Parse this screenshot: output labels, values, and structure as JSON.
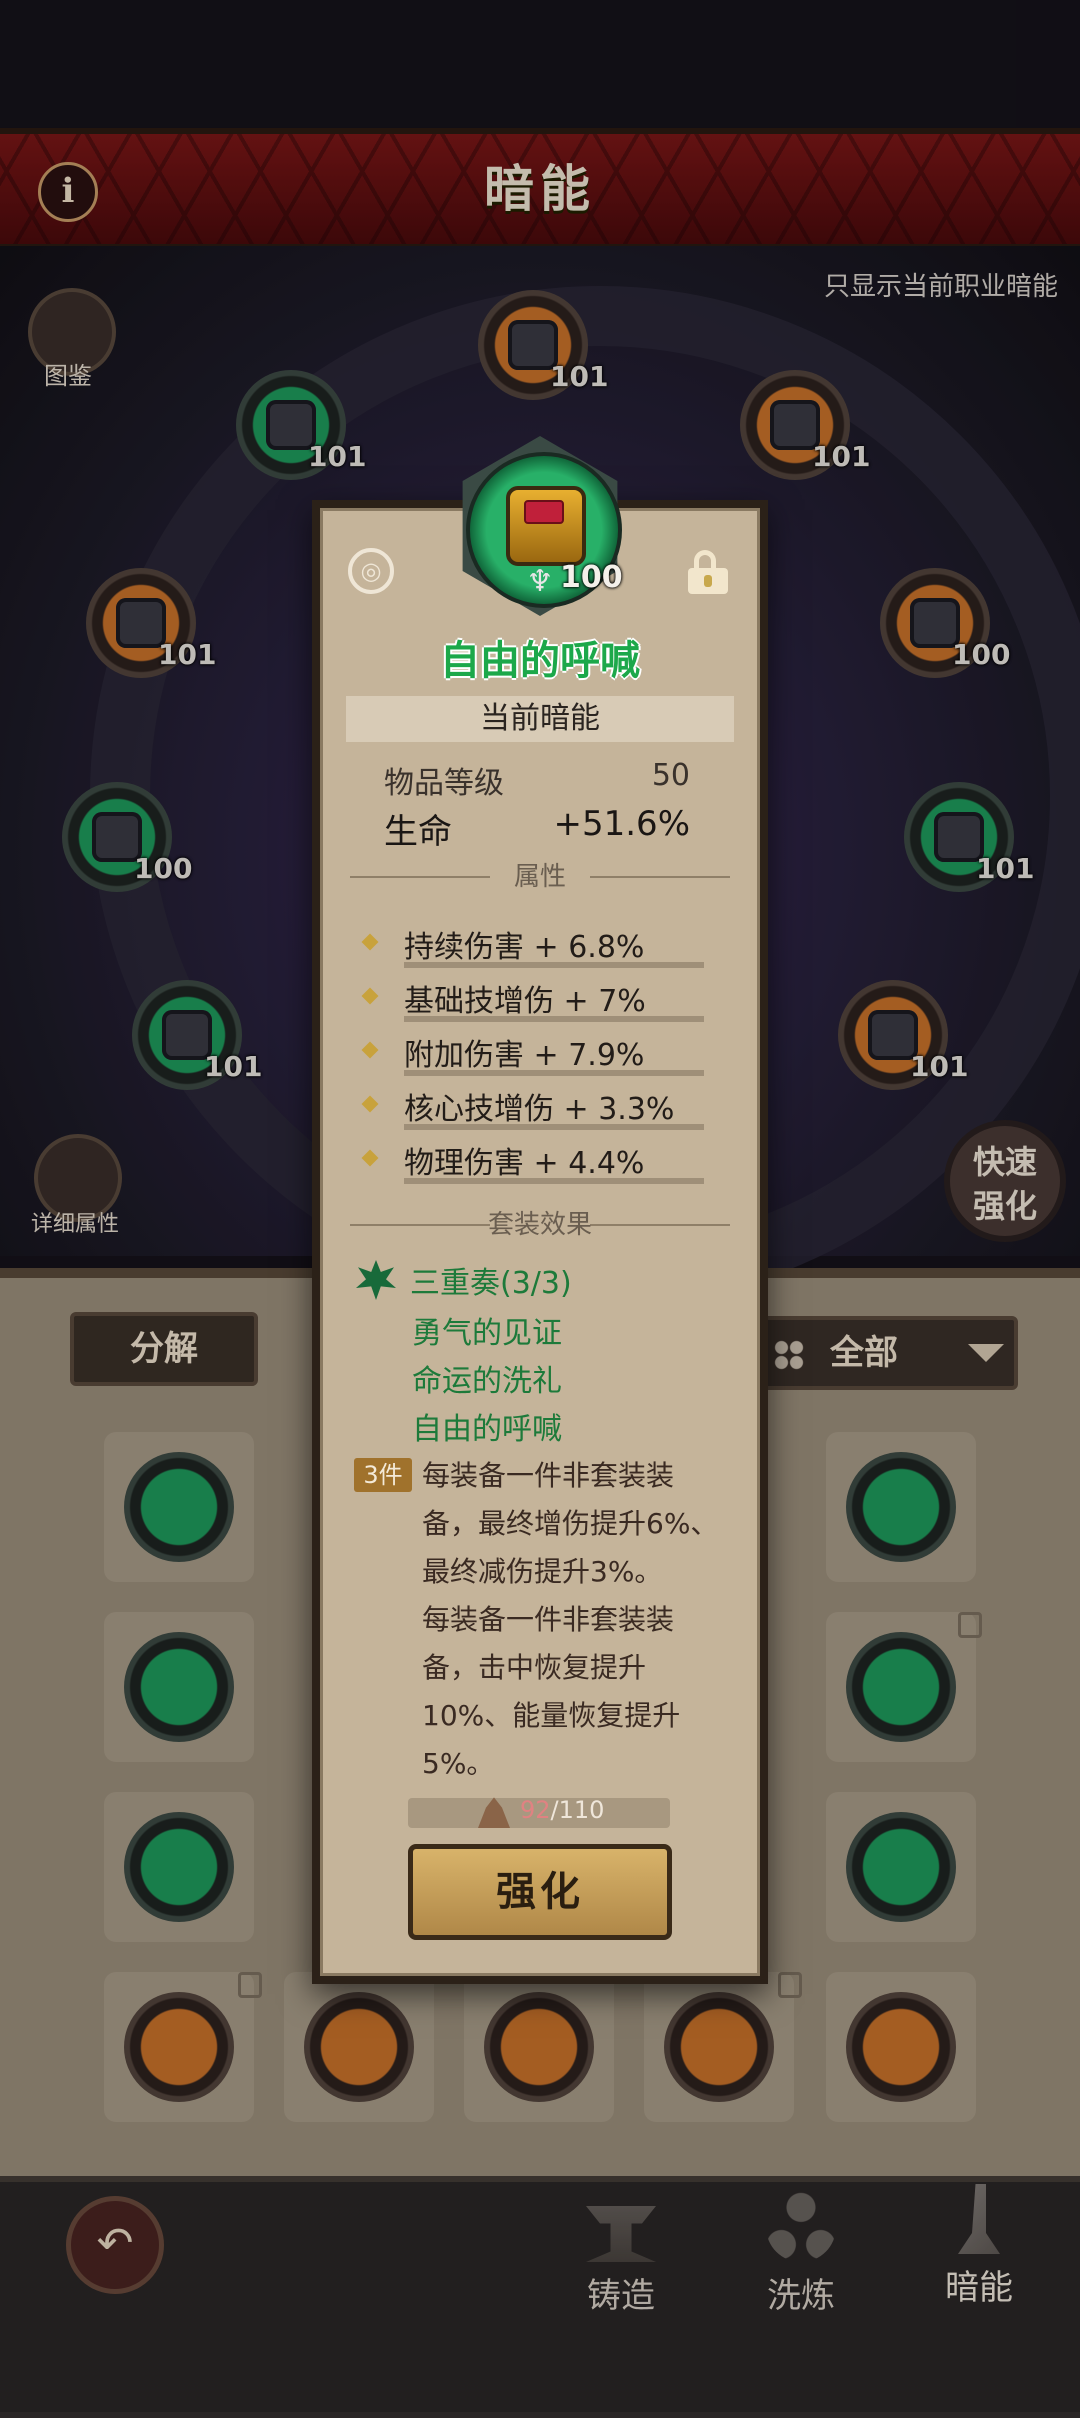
{
  "header": {
    "title": "暗能",
    "info_icon": "info-icon"
  },
  "scene": {
    "only_current_class": "只显示当前职业暗能",
    "codex_label": "图鉴",
    "detail_attr_label": "详细属性",
    "quick_enhance_label_1": "快速",
    "quick_enhance_label_2": "强化",
    "slots": [
      {
        "level": "101",
        "rarity": "orange"
      },
      {
        "level": "101",
        "rarity": "green"
      },
      {
        "level": "101",
        "rarity": "orange"
      },
      {
        "level": "101",
        "rarity": "orange"
      },
      {
        "level": "100",
        "rarity": "orange"
      },
      {
        "level": "100",
        "rarity": "green"
      },
      {
        "level": "101",
        "rarity": "green"
      },
      {
        "level": "101",
        "rarity": "green"
      },
      {
        "level": "101",
        "rarity": "orange"
      }
    ]
  },
  "inventory": {
    "decompose_label": "分解",
    "filter_label": "全部"
  },
  "detail": {
    "item_level_badge": "100",
    "item_name": "自由的呼喊",
    "current_label": "当前暗能",
    "item_level_label": "物品等级",
    "item_level_value": "50",
    "main_stat_label": "生命",
    "main_stat_value": "+51.6%",
    "attr_divider": "属性",
    "attributes": [
      {
        "text": "持续伤害 + 6.8%",
        "fill": 0.72
      },
      {
        "text": "基础技增伤 + 7%",
        "fill": 0.62
      },
      {
        "text": "附加伤害 + 7.9%",
        "fill": 0.8
      },
      {
        "text": "核心技增伤 + 3.3%",
        "fill": 0.4
      },
      {
        "text": "物理伤害 + 4.4%",
        "fill": 0.5
      }
    ],
    "set_divider": "套装效果",
    "set_name": "三重奏(3/3)",
    "set_pieces": [
      "勇气的见证",
      "命运的洗礼",
      "自由的呼喊"
    ],
    "set_badge": "3件",
    "set_effect_1": "每装备一件非套装装备，最终增伤提升6%、最终减伤提升3%。",
    "set_effect_2": "每装备一件非套装装备，击中恢复提升10%、能量恢复提升5%。",
    "material_current": "92",
    "material_total": "/110",
    "enhance_label": "强化"
  },
  "nav": {
    "back_icon": "back-arrow-icon",
    "forge": "铸造",
    "refine": "洗炼",
    "dark_energy": "暗能"
  },
  "colors": {
    "header_red": "#7a1616",
    "rarity_orange": "#c8722a",
    "rarity_green": "#1e9a5c",
    "set_green": "#1d7a3a",
    "panel_bg": "#c5b49a"
  }
}
